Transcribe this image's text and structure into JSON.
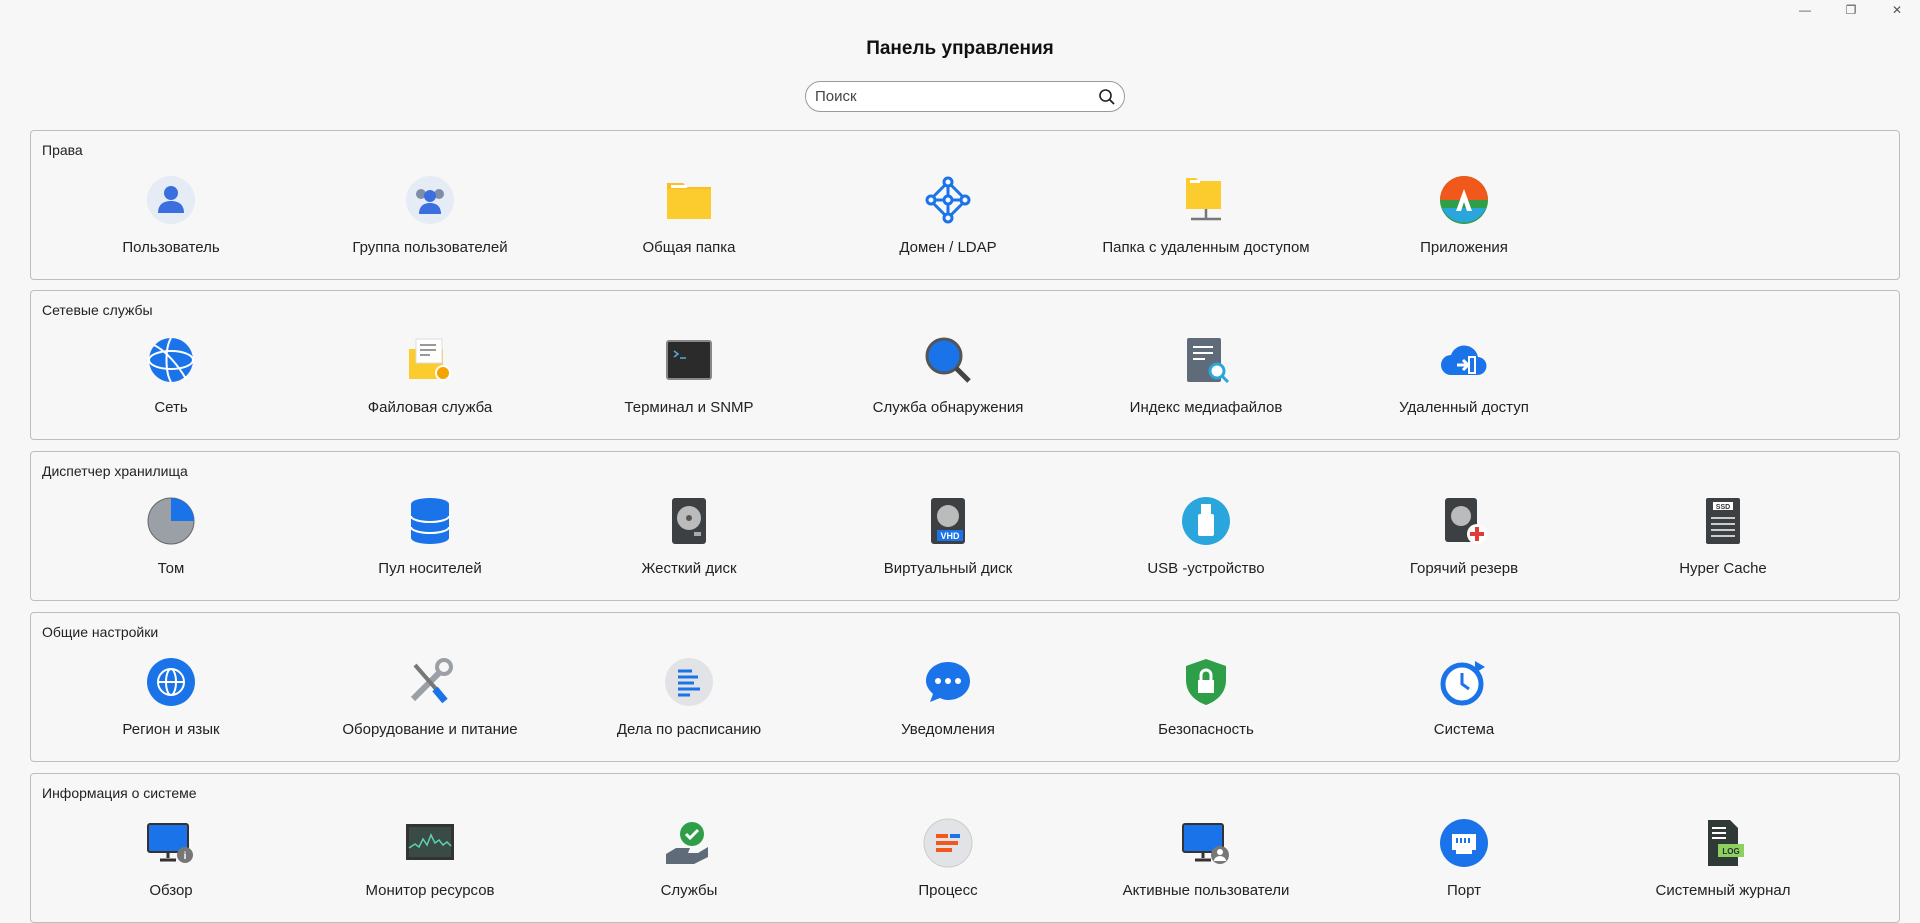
{
  "window": {
    "minimize": "—",
    "restore": "❐",
    "close": "✕"
  },
  "title": "Панель управления",
  "search": {
    "placeholder": "Поиск",
    "value": ""
  },
  "sections": [
    {
      "title": "Права",
      "items": [
        {
          "label": "Пользователь",
          "icon": "user-icon"
        },
        {
          "label": "Группа пользователей",
          "icon": "user-group-icon"
        },
        {
          "label": "Общая папка",
          "icon": "shared-folder-icon"
        },
        {
          "label": "Домен / LDAP",
          "icon": "domain-ldap-icon"
        },
        {
          "label": "Папка с удаленным доступом",
          "icon": "remote-folder-icon"
        },
        {
          "label": "Приложения",
          "icon": "applications-icon"
        }
      ]
    },
    {
      "title": "Сетевые службы",
      "items": [
        {
          "label": "Сеть",
          "icon": "network-globe-icon"
        },
        {
          "label": "Файловая служба",
          "icon": "file-service-icon"
        },
        {
          "label": "Терминал и SNMP",
          "icon": "terminal-icon"
        },
        {
          "label": "Служба обнаружения",
          "icon": "discovery-magnifier-icon"
        },
        {
          "label": "Индекс медиафайлов",
          "icon": "media-index-icon"
        },
        {
          "label": "Удаленный доступ",
          "icon": "remote-access-cloud-icon"
        }
      ]
    },
    {
      "title": "Диспетчер хранилища",
      "items": [
        {
          "label": "Том",
          "icon": "volume-pie-icon"
        },
        {
          "label": "Пул носителей",
          "icon": "storage-pool-icon"
        },
        {
          "label": "Жесткий диск",
          "icon": "hard-disk-icon"
        },
        {
          "label": "Виртуальный диск",
          "icon": "virtual-disk-vhd-icon"
        },
        {
          "label": "USB -устройство",
          "icon": "usb-device-icon"
        },
        {
          "label": "Горячий резерв",
          "icon": "hot-spare-icon"
        },
        {
          "label": "Hyper Cache",
          "icon": "ssd-cache-icon"
        }
      ]
    },
    {
      "title": "Общие настройки",
      "items": [
        {
          "label": "Регион и язык",
          "icon": "region-globe-icon"
        },
        {
          "label": "Оборудование и питание",
          "icon": "hardware-tools-icon"
        },
        {
          "label": "Дела по расписанию",
          "icon": "scheduled-tasks-icon"
        },
        {
          "label": "Уведомления",
          "icon": "notification-chat-icon"
        },
        {
          "label": "Безопасность",
          "icon": "security-shield-icon"
        },
        {
          "label": "Система",
          "icon": "system-clock-icon"
        }
      ]
    },
    {
      "title": "Информация о системе",
      "items": [
        {
          "label": "Обзор",
          "icon": "overview-monitor-icon"
        },
        {
          "label": "Монитор ресурсов",
          "icon": "resource-monitor-icon"
        },
        {
          "label": "Службы",
          "icon": "services-check-icon"
        },
        {
          "label": "Процесс",
          "icon": "process-icon"
        },
        {
          "label": "Активные пользователи",
          "icon": "active-users-icon"
        },
        {
          "label": "Порт",
          "icon": "port-icon"
        },
        {
          "label": "Системный журнал",
          "icon": "system-log-icon"
        }
      ]
    }
  ]
}
